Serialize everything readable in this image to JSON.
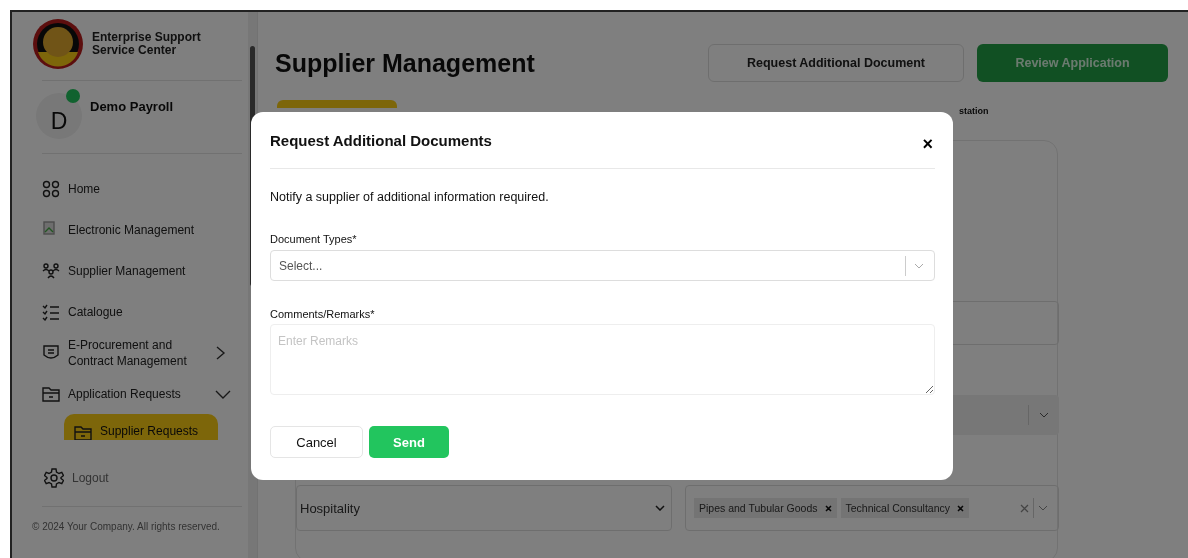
{
  "sidebar": {
    "org_name": "Enterprise Support Service Center",
    "user": {
      "initial": "D",
      "name": "Demo Payroll",
      "online": true
    },
    "items": [
      {
        "label": "Home",
        "kind": "grid",
        "selected": false
      },
      {
        "label": "Electronic Management",
        "kind": "broken",
        "selected": false
      },
      {
        "label": "Supplier Management",
        "kind": "people",
        "selected": false
      },
      {
        "label": "Catalogue",
        "kind": "list",
        "selected": false
      },
      {
        "label": "E-Procurement and Contract Management",
        "kind": "shield",
        "selected": false,
        "expanded": false
      },
      {
        "label": "Application Requests",
        "kind": "folder",
        "selected": false,
        "expanded": true,
        "children": [
          {
            "label": "Supplier Requests",
            "kind": "folder",
            "selected": true
          }
        ]
      }
    ],
    "logout": "Logout",
    "footer": "© 2024 Your Company. All rights reserved."
  },
  "page": {
    "title": "Supplier Management",
    "buttons": [
      {
        "label": "Request Additional Document",
        "kind": "outline"
      },
      {
        "label": "Review Application",
        "kind": "primary"
      }
    ],
    "label_fragment": "station",
    "category": {
      "value": "Hospitality"
    },
    "tags": [
      "Pipes and Tubular Goods",
      "Technical Consultancy"
    ]
  },
  "modal": {
    "title": "Request Additional Documents",
    "close": "×",
    "description": "Notify a supplier of additional information required.",
    "document_types": {
      "label": "Document Types*",
      "placeholder": "Select..."
    },
    "comments": {
      "label": "Comments/Remarks*",
      "placeholder": "Enter Remarks"
    },
    "buttons": [
      {
        "label": "Cancel",
        "kind": "secondary"
      },
      {
        "label": "Send",
        "kind": "primary"
      }
    ]
  }
}
